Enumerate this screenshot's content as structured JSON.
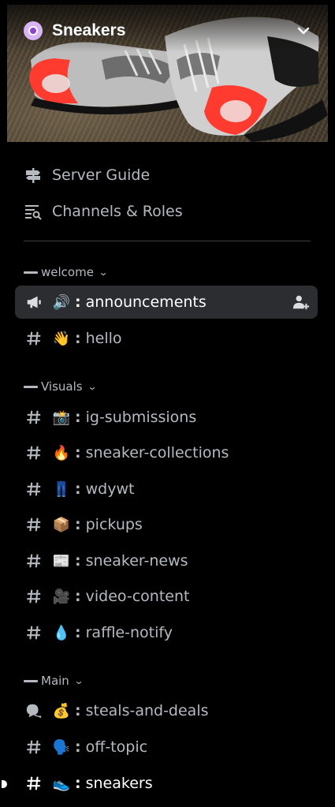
{
  "server": {
    "name": "Sneakers",
    "icon": "server-icon",
    "menu_icon": "chevron-down-icon"
  },
  "utilities": [
    {
      "label": "Server Guide",
      "icon": "signpost-icon"
    },
    {
      "label": "Channels & Roles",
      "icon": "list-search-icon"
    }
  ],
  "categories": [
    {
      "name": "welcome",
      "channels": [
        {
          "emoji": "🔊",
          "name": "announcements",
          "type": "announcement",
          "active": true
        },
        {
          "emoji": "👋",
          "name": "hello",
          "type": "text"
        }
      ]
    },
    {
      "name": "Visuals",
      "channels": [
        {
          "emoji": "📸",
          "name": "ig-submissions",
          "type": "text"
        },
        {
          "emoji": "🔥",
          "name": "sneaker-collections",
          "type": "text"
        },
        {
          "emoji": "👖",
          "name": "wdywt",
          "type": "text"
        },
        {
          "emoji": "📦",
          "name": "pickups",
          "type": "text"
        },
        {
          "emoji": "📰",
          "name": "sneaker-news",
          "type": "text"
        },
        {
          "emoji": "🎥",
          "name": "video-content",
          "type": "text"
        },
        {
          "emoji": "💧",
          "name": "raffle-notify",
          "type": "text"
        }
      ]
    },
    {
      "name": "Main",
      "channels": [
        {
          "emoji": "💰",
          "name": "steals-and-deals",
          "type": "forum"
        },
        {
          "emoji": "🗣️",
          "name": "off-topic",
          "type": "text"
        },
        {
          "emoji": "👟",
          "name": "sneakers",
          "type": "text",
          "unread": true
        }
      ]
    }
  ],
  "colors": {
    "background": "#000000",
    "active_channel_bg": "#2b2d31",
    "muted_text": "#b5bac1",
    "scrollbar": "#c58a4b",
    "server_icon_bg": "#d9b4f5"
  }
}
